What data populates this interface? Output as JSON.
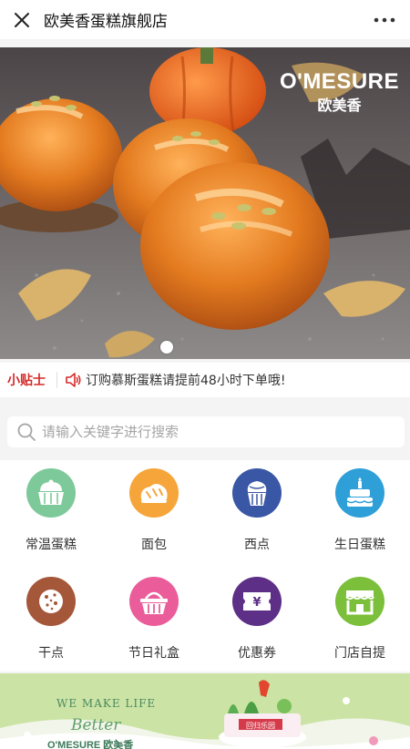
{
  "header": {
    "title": "欧美香蛋糕旗舰店"
  },
  "banner": {
    "brand_en": "O'MESURE",
    "brand_cn": "欧美香"
  },
  "tips": {
    "label": "小贴士",
    "text": "订购慕斯蛋糕请提前48小时下单哦!"
  },
  "search": {
    "placeholder": "请输入关键字进行搜索"
  },
  "categories": [
    {
      "label": "常温蛋糕",
      "icon": "cake-icon",
      "color": "#7dc99a"
    },
    {
      "label": "面包",
      "icon": "bread-icon",
      "color": "#f6a53a"
    },
    {
      "label": "西点",
      "icon": "dessert-icon",
      "color": "#3a57a6"
    },
    {
      "label": "生日蛋糕",
      "icon": "birthday-cake-icon",
      "color": "#2f9fd8"
    },
    {
      "label": "干点",
      "icon": "cookie-icon",
      "color": "#a5573a"
    },
    {
      "label": "节日礼盒",
      "icon": "gift-basket-icon",
      "color": "#ea5d9a"
    },
    {
      "label": "优惠券",
      "icon": "coupon-icon",
      "color": "#5d2f86"
    },
    {
      "label": "门店自提",
      "icon": "store-icon",
      "color": "#7bbf3a"
    }
  ],
  "promo": {
    "line1": "WE MAKE LIFE",
    "line2": "Better",
    "brand": "O'MESURE 欧美香",
    "badge": "回归乐园"
  }
}
